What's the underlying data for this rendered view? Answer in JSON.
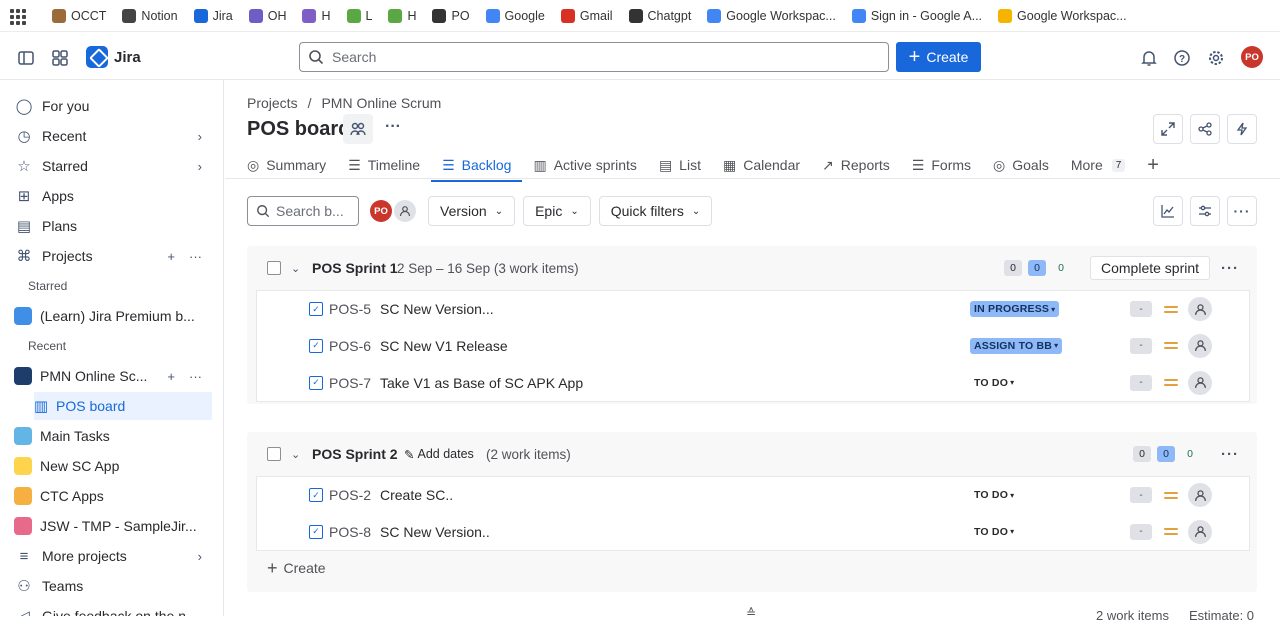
{
  "bookmarks": [
    {
      "label": "OCCT",
      "icon": "box-icon",
      "color": "#9c6b3b"
    },
    {
      "label": "Notion",
      "icon": "home-icon",
      "color": "#444444"
    },
    {
      "label": "Jira",
      "icon": "jira-icon",
      "color": "#1868db"
    },
    {
      "label": "OH",
      "icon": "oh-icon",
      "color": "#6e5dc6"
    },
    {
      "label": "H",
      "icon": "s-icon",
      "color": "#7f5fc7"
    },
    {
      "label": "L",
      "icon": "l-icon",
      "color": "#5aa844"
    },
    {
      "label": "H",
      "icon": "h-icon",
      "color": "#5aa844"
    },
    {
      "label": "PO",
      "icon": "globe-icon",
      "color": "#333333"
    },
    {
      "label": "Google",
      "icon": "google-icon",
      "color": "#4285f4"
    },
    {
      "label": "Gmail",
      "icon": "gmail-icon",
      "color": "#d93025"
    },
    {
      "label": "Chatgpt",
      "icon": "chatgpt-icon",
      "color": "#333333"
    },
    {
      "label": "Google Workspac...",
      "icon": "google-icon",
      "color": "#4285f4"
    },
    {
      "label": "Sign in - Google A...",
      "icon": "google-icon",
      "color": "#4285f4"
    },
    {
      "label": "Google Workspac...",
      "icon": "workspace-icon",
      "color": "#f4b400"
    }
  ],
  "topnav": {
    "app_name": "Jira",
    "search_placeholder": "Search",
    "create_label": "Create",
    "avatar_initials": "PO"
  },
  "sidebar": {
    "items": [
      {
        "label": "For you"
      },
      {
        "label": "Recent"
      },
      {
        "label": "Starred"
      },
      {
        "label": "Apps"
      },
      {
        "label": "Plans"
      },
      {
        "label": "Projects"
      }
    ],
    "starred_heading": "Starred",
    "starred_project": "(Learn) Jira Premium b...",
    "recent_heading": "Recent",
    "recent_project": "PMN Online Sc...",
    "board_label": "POS board",
    "projects": [
      {
        "label": "Main Tasks",
        "color": "#62b5e5"
      },
      {
        "label": "New SC App",
        "color": "#ffd44d"
      },
      {
        "label": "CTC Apps",
        "color": "#f5b041"
      },
      {
        "label": "JSW - TMP - SampleJir...",
        "color": "#e86a8b"
      }
    ],
    "more_projects": "More projects",
    "teams": "Teams",
    "feedback": "Give feedback on the n..."
  },
  "main": {
    "breadcrumb_projects": "Projects",
    "breadcrumb_sep": "/",
    "breadcrumb_project": "PMN Online Scrum",
    "title": "POS board",
    "more_dots": "···",
    "tabs": [
      {
        "label": "Summary"
      },
      {
        "label": "Timeline"
      },
      {
        "label": "Backlog"
      },
      {
        "label": "Active sprints"
      },
      {
        "label": "List"
      },
      {
        "label": "Calendar"
      },
      {
        "label": "Reports"
      },
      {
        "label": "Forms"
      },
      {
        "label": "Goals"
      },
      {
        "label": "More",
        "badge": "7"
      }
    ],
    "filter_search_placeholder": "Search b...",
    "filter_avatar": "PO",
    "filters": [
      "Version",
      "Epic",
      "Quick filters"
    ]
  },
  "sprints": [
    {
      "name": "POS Sprint 1",
      "meta": "2 Sep – 16 Sep (3 work items)",
      "counts": [
        "0",
        "0",
        "0"
      ],
      "complete_label": "Complete sprint",
      "items": [
        {
          "key": "POS-5",
          "summary": "SC New Version...",
          "status": "IN PROGRESS",
          "status_style": "blue",
          "estimate": "-"
        },
        {
          "key": "POS-6",
          "summary": "SC New V1 Release",
          "status": "ASSIGN TO BB",
          "status_style": "blue",
          "estimate": "-"
        },
        {
          "key": "POS-7",
          "summary": "Take V1 as Base of SC APK App",
          "status": "TO DO",
          "status_style": "gray",
          "estimate": "-"
        }
      ]
    },
    {
      "name": "POS Sprint 2",
      "add_dates": "Add dates",
      "meta": "(2 work items)",
      "counts": [
        "0",
        "0",
        "0"
      ],
      "items": [
        {
          "key": "POS-2",
          "summary": "Create SC..",
          "status": "TO DO",
          "status_style": "gray",
          "estimate": "-"
        },
        {
          "key": "POS-8",
          "summary": "SC New Version..",
          "status": "TO DO",
          "status_style": "gray",
          "estimate": "-"
        }
      ],
      "create_label": "Create"
    }
  ],
  "footer": {
    "work_items": "2 work items",
    "estimate": "Estimate: 0"
  }
}
